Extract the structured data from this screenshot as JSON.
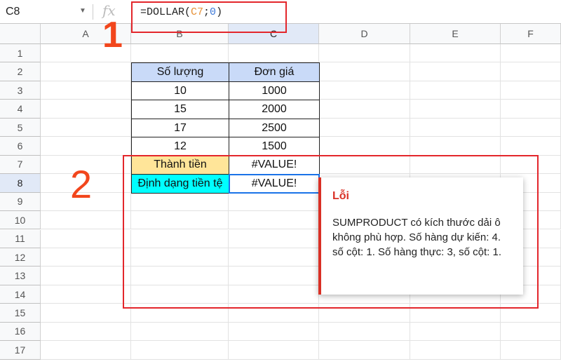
{
  "formula_bar": {
    "name_box": "C8",
    "fx": "fx",
    "formula_prefix": "=DOLLAR(",
    "formula_ref": "C7",
    "formula_sep": ";",
    "formula_num": "0",
    "formula_suffix": ")"
  },
  "columns": [
    "A",
    "B",
    "C",
    "D",
    "E",
    "F"
  ],
  "rows": [
    "1",
    "2",
    "3",
    "4",
    "5",
    "6",
    "7",
    "8",
    "9",
    "10",
    "11",
    "12",
    "13",
    "14",
    "15",
    "16",
    "17"
  ],
  "table": {
    "headers": [
      "Số lượng",
      "Đơn giá"
    ],
    "data": [
      [
        "10",
        "1000"
      ],
      [
        "15",
        "2000"
      ],
      [
        "17",
        "2500"
      ],
      [
        "12",
        "1500"
      ]
    ],
    "total_label": "Thành tiền",
    "total_value": "#VALUE!",
    "format_label": "Định dạng tiền tệ",
    "format_value": "#VALUE!"
  },
  "error_tooltip": {
    "title": "Lỗi",
    "message": "SUMPRODUCT có kích thước dải ô không phù hợp. Số hàng dự kiến: 4. số cột: 1. Số hàng thực: 3, số cột: 1."
  },
  "annotations": {
    "one": "1",
    "two": "2"
  },
  "colors": {
    "header_fill": "#c9daf8",
    "total_fill": "#ffe599",
    "format_fill": "#00ffff",
    "annotation": "#e3262b",
    "error": "#d93025"
  }
}
